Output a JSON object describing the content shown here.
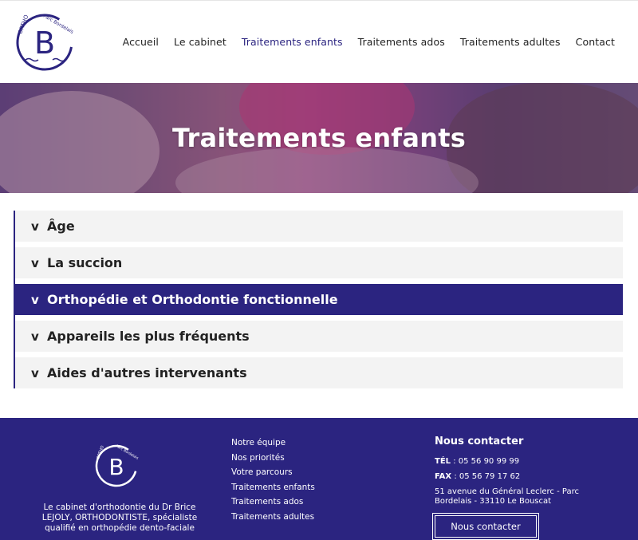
{
  "colors": {
    "brand": "#2b2480",
    "panel": "#f3f3f3",
    "text": "#222222"
  },
  "logo": {
    "main_text": "ORTHO",
    "sub_text": "Parc Bordelais",
    "letter": "B"
  },
  "nav": {
    "items": [
      {
        "label": "Accueil"
      },
      {
        "label": "Le cabinet"
      },
      {
        "label": "Traitements enfants"
      },
      {
        "label": "Traitements ados"
      },
      {
        "label": "Traitements adultes"
      },
      {
        "label": "Contact"
      }
    ]
  },
  "hero": {
    "title": "Traitements enfants"
  },
  "accordion": {
    "items": [
      {
        "label": "Âge",
        "icon": "chevron-down-icon"
      },
      {
        "label": "La succion",
        "icon": "chevron-down-icon"
      },
      {
        "label": "Orthopédie et Orthodontie fonctionnelle",
        "icon": "chevron-down-icon",
        "active": true
      },
      {
        "label": "Appareils les plus fréquents",
        "icon": "chevron-down-icon"
      },
      {
        "label": "Aides d'autres intervenants",
        "icon": "chevron-down-icon"
      }
    ]
  },
  "footer": {
    "description": "Le cabinet d'orthodontie du Dr Brice LEJOLY, ORTHODONTISTE, spécialiste qualifié en orthopédie dento-faciale",
    "links": [
      {
        "label": "Notre équipe"
      },
      {
        "label": "Nos priorités"
      },
      {
        "label": "Votre parcours"
      },
      {
        "label": "Traitements enfants"
      },
      {
        "label": "Traitements ados"
      },
      {
        "label": "Traitements adultes"
      }
    ],
    "contact": {
      "title": "Nous contacter",
      "tel_label": "TÉL",
      "tel_value": " : 05 56 90 99 99",
      "fax_label": "FAX",
      "fax_value": " : 05 56 79 17 62",
      "address": "51 avenue du Général Leclerc - Parc Bordelais - 33110 Le Bouscat",
      "button_label": "Nous contacter"
    }
  }
}
